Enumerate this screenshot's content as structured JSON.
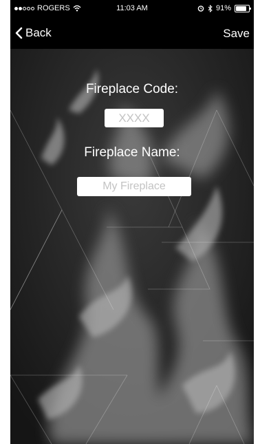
{
  "status_bar": {
    "carrier": "ROGERS",
    "time": "11:03 AM",
    "battery": "91%",
    "signal_bars": 2,
    "battery_fraction": 0.91
  },
  "nav": {
    "back_label": "Back",
    "save_label": "Save"
  },
  "form": {
    "code_label": "Fireplace Code:",
    "code_placeholder": "XXXX",
    "name_label": "Fireplace Name:",
    "name_placeholder": "My Fireplace"
  },
  "colors": {
    "nav_bg": "#000000",
    "text": "#ffffff",
    "input_bg": "#ffffff",
    "placeholder": "#c3c3c3"
  }
}
